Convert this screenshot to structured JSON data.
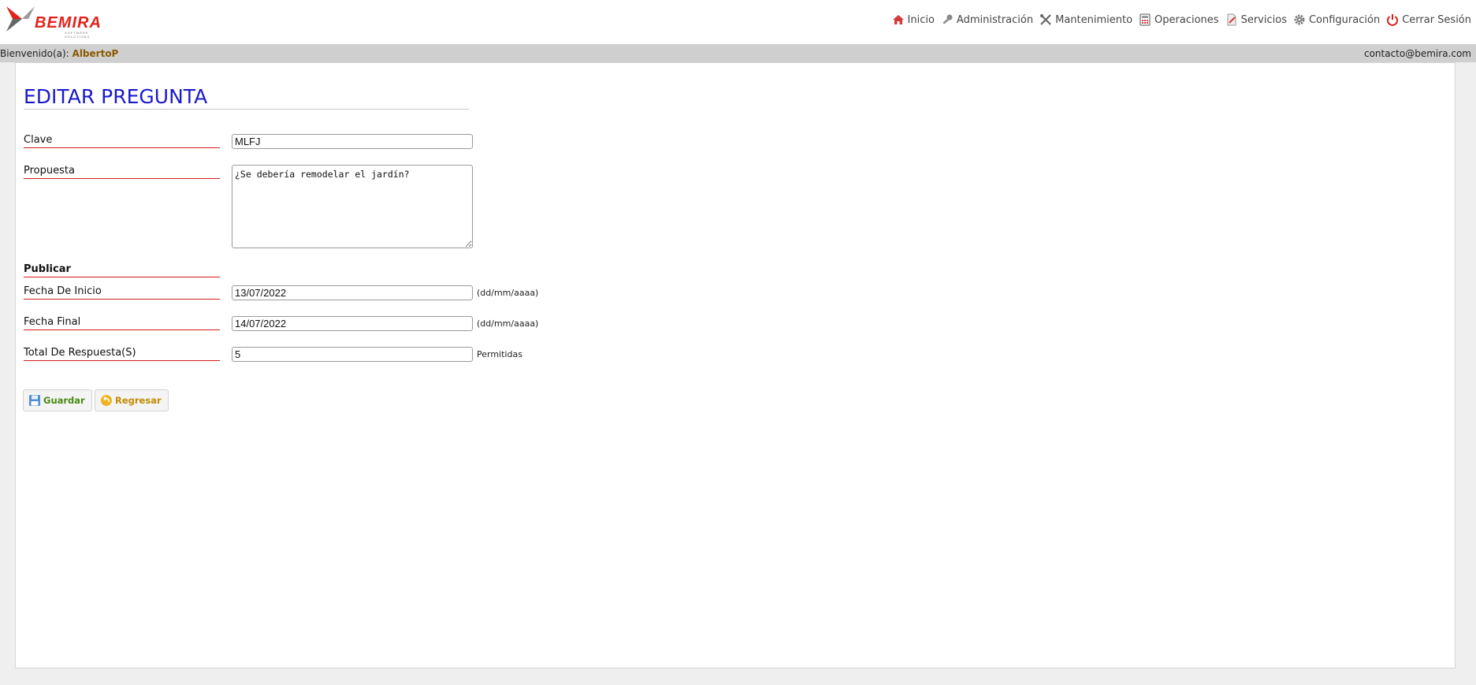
{
  "header": {
    "logo_text": "BEMIRA",
    "logo_subtitle": "SOFTWARE SOLUTIONS",
    "nav": [
      {
        "label": "Inicio",
        "icon": "home-icon"
      },
      {
        "label": "Administración",
        "icon": "key-icon"
      },
      {
        "label": "Mantenimiento",
        "icon": "tools-icon"
      },
      {
        "label": "Operaciones",
        "icon": "calculator-icon"
      },
      {
        "label": "Servicios",
        "icon": "document-edit-icon"
      },
      {
        "label": "Configuración",
        "icon": "gear-icon"
      },
      {
        "label": "Cerrar Sesión",
        "icon": "power-icon"
      }
    ]
  },
  "welcome": {
    "prefix": "Bienvenido(a):",
    "user": "AlbertoP",
    "email": "contacto@bemira.com"
  },
  "form": {
    "title": "EDITAR PREGUNTA",
    "clave_label": "Clave",
    "clave_value": "MLFJ",
    "propuesta_label": "Propuesta",
    "propuesta_value": "¿Se debería remodelar el jardín?",
    "publicar_label": "Publicar",
    "fecha_inicio_label": "Fecha De Inicio",
    "fecha_inicio_value": "13/07/2022",
    "fecha_inicio_hint": "(dd/mm/aaaa)",
    "fecha_final_label": "Fecha Final",
    "fecha_final_value": "14/07/2022",
    "fecha_final_hint": "(dd/mm/aaaa)",
    "total_label": "Total De Respuesta(S)",
    "total_value": "5",
    "total_hint": "Permitidas",
    "save_label": "Guardar",
    "back_label": "Regresar"
  },
  "colors": {
    "title": "#1a1acd",
    "label_underline": "#d21c1c",
    "welcome_bar": "#cfcfcf",
    "username": "#8b5a00",
    "save_text": "#4a8a14",
    "back_text": "#c28a00"
  }
}
